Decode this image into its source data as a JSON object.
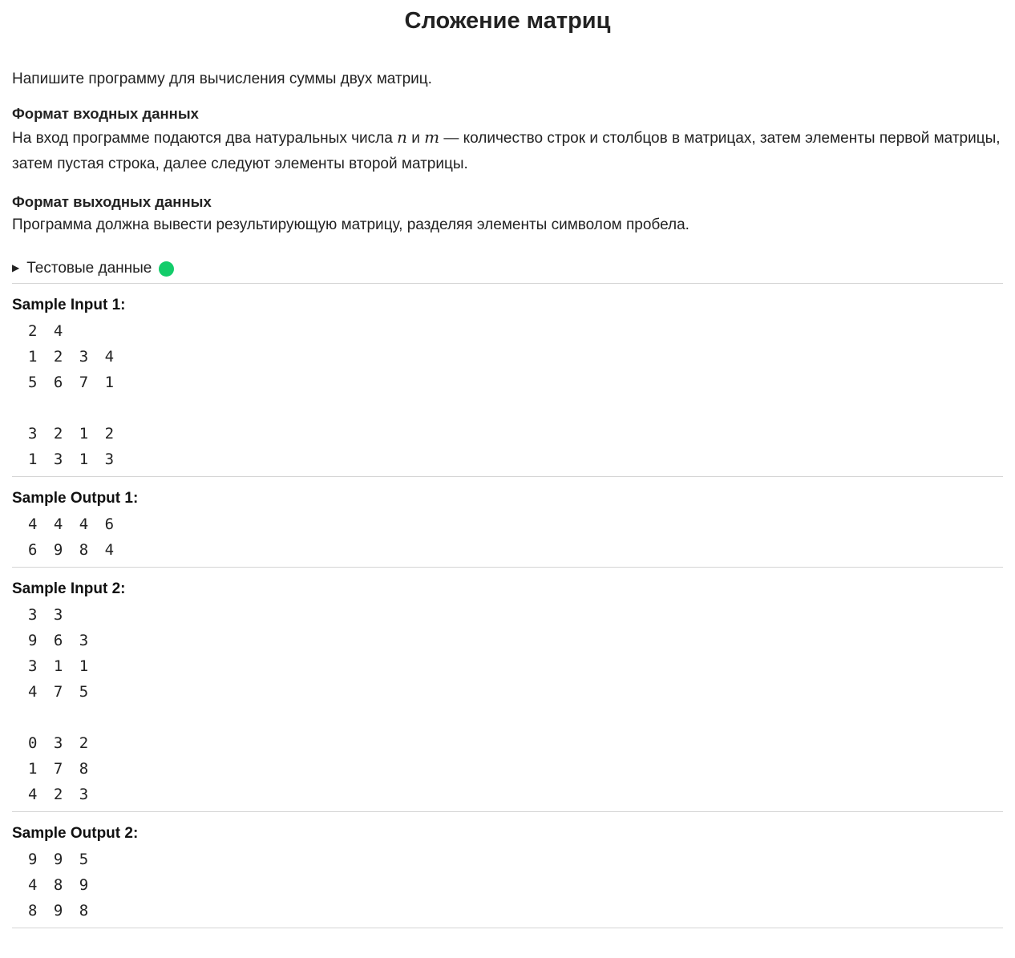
{
  "title": "Сложение матриц",
  "intro": "Напишите программу для вычисления суммы двух матриц.",
  "input_format": {
    "heading": "Формат входных данных",
    "text_before": "На вход программе подаются два натуральных числа ",
    "var_n": "n",
    "and": " и ",
    "var_m": "m",
    "text_after": " — количество строк и столбцов в матрицах, затем элементы первой матрицы, затем пустая строка, далее следуют элементы второй матрицы."
  },
  "output_format": {
    "heading": "Формат выходных данных",
    "text": "Программа должна вывести результирующую матрицу, разделяя элементы символом пробела."
  },
  "test_data": {
    "label": "Тестовые данные",
    "status_color": "#13cc6a",
    "icon": "triangle-right-icon"
  },
  "samples": [
    {
      "label": "Sample Input 1:",
      "lines": [
        "2 4",
        "1 2 3 4",
        "5 6 7 1",
        "",
        "3 2 1 2",
        "1 3 1 3"
      ]
    },
    {
      "label": "Sample Output 1:",
      "lines": [
        "4 4 4 6",
        "6 9 8 4"
      ]
    },
    {
      "label": "Sample Input 2:",
      "lines": [
        "3 3",
        "9 6 3",
        "3 1 1",
        "4 7 5",
        "",
        "0 3 2",
        "1 7 8",
        "4 2 3"
      ]
    },
    {
      "label": "Sample Output 2:",
      "lines": [
        "9 9 5",
        "4 8 9",
        "8 9 8"
      ]
    }
  ]
}
